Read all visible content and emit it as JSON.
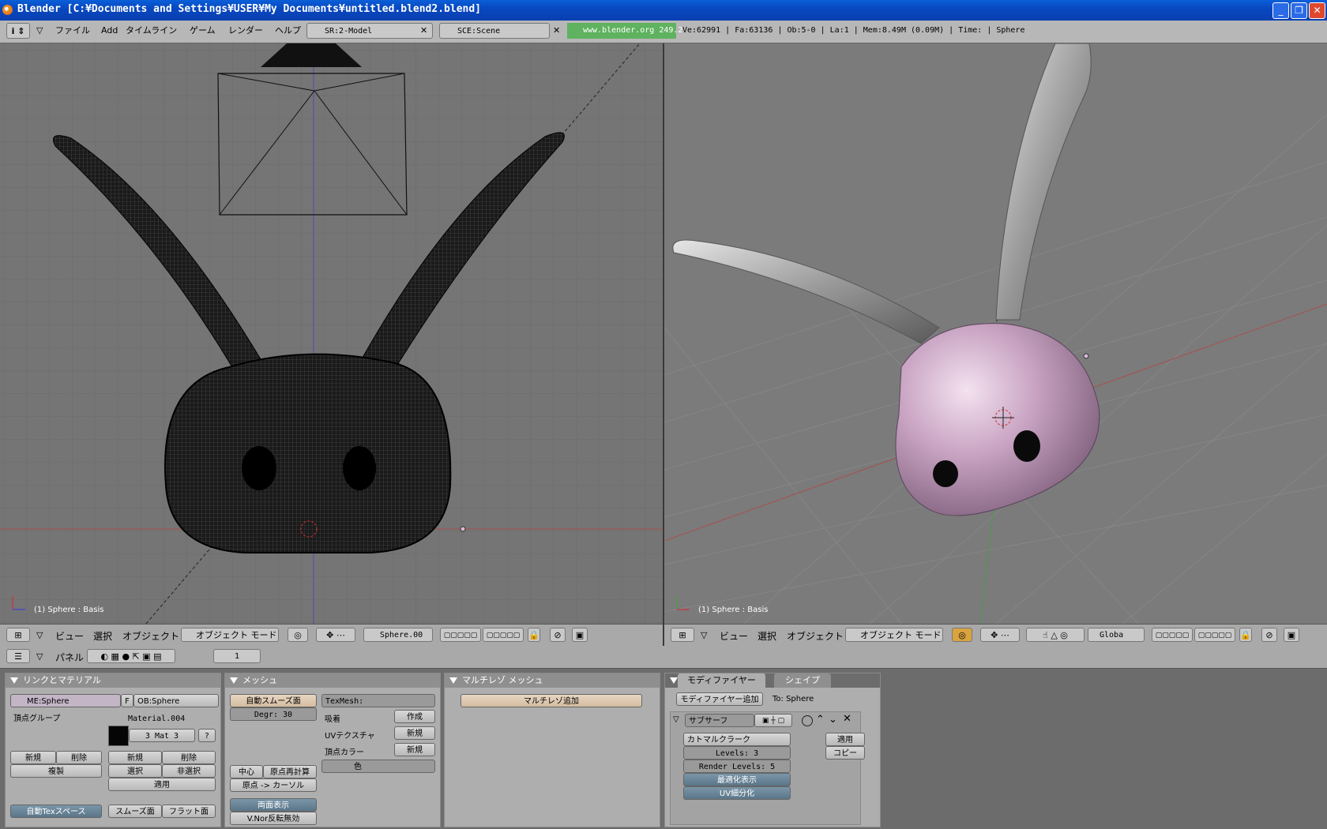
{
  "window": {
    "title": "Blender [C:¥Documents and Settings¥USER¥My Documents¥untitled.blend2.blend]",
    "min_label": "_",
    "max_label": "❐",
    "close_label": "✕"
  },
  "menubar": {
    "items": [
      "ファイル",
      "Add",
      "タイムライン",
      "ゲーム",
      "レンダー",
      "ヘルプ"
    ],
    "screen": "SR:2-Model",
    "scene": "SCE:Scene",
    "url": "www.blender.org 249.2",
    "stats": "Ve:62991 | Fa:63136 | Ob:5-0 | La:1  | Mem:8.49M (0.09M)  | Time: | Sphere"
  },
  "viewport_left": {
    "object_label": "(1) Sphere : Basis",
    "header": {
      "view": "ビュー",
      "select": "選択",
      "object": "オブジェクト",
      "mode": "オブジェクト モード",
      "pivot_object": "Sphere.00"
    }
  },
  "viewport_right": {
    "object_label": "(1) Sphere : Basis",
    "header": {
      "view": "ビュー",
      "select": "選択",
      "object": "オブジェクト",
      "mode": "オブジェクト モード",
      "orientation": "Globa"
    }
  },
  "buttons_header": {
    "panels_label": "パネル",
    "frame": "1"
  },
  "panel_link": {
    "title": "リンクとマテリアル",
    "mesh_name": "ME:Sphere",
    "f_label": "F",
    "ob_name": "OB:Sphere",
    "vertex_groups": "頂点グループ",
    "material": "Material.004",
    "mat_index": "3 Mat 3",
    "question": "?",
    "new1": "新規",
    "delete1": "削除",
    "copy": "複製",
    "new2": "新規",
    "delete2": "削除",
    "select": "選択",
    "deselect": "非選択",
    "apply": "適用",
    "auto_tex": "自動Texスペース",
    "smooth": "スムーズ面",
    "flat": "フラット面"
  },
  "panel_mesh": {
    "title": "メッシュ",
    "auto_smooth": "自動スムーズ面",
    "degr": "Degr: 30",
    "texmesh": "TexMesh:",
    "sticky": "吸着",
    "make": "作成",
    "uv_tex": "UVテクスチャ",
    "uv_new": "新規",
    "vcol": "頂点カラー",
    "vcol_new": "新規",
    "color": "色",
    "center": "中心",
    "center_new": "原点再計算",
    "center_cursor": "原点 -> カーソル",
    "double_sided": "両面表示",
    "no_vnormal": "V.Nor反転無効"
  },
  "panel_multires": {
    "title": "マルチレゾ メッシュ",
    "add": "マルチレゾ追加"
  },
  "panel_modifiers": {
    "tab_modifiers": "モディファイヤー",
    "tab_shapes": "シェイプ",
    "add": "モディファイヤー追加",
    "to": "To: Sphere",
    "subsurf": "サブサーフ",
    "type": "カトマルクラーク",
    "levels": "Levels: 3",
    "render_levels": "Render Levels: 5",
    "optimal": "最適化表示",
    "uv_subdiv": "UV細分化",
    "apply": "適用",
    "copy": "コピー"
  }
}
